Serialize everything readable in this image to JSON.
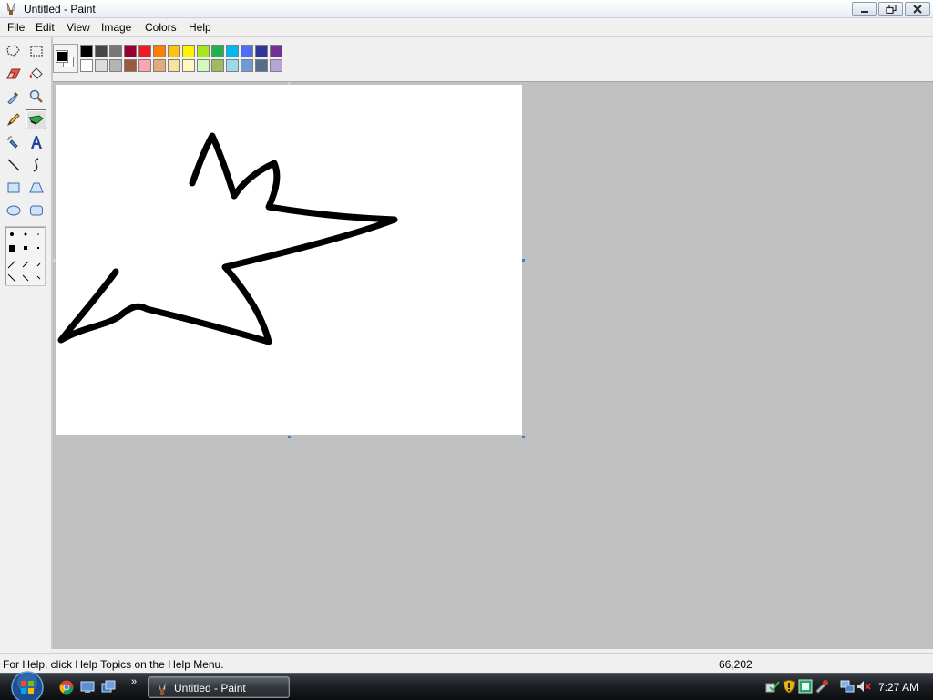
{
  "window": {
    "title": "Untitled - Paint"
  },
  "menu": {
    "items": [
      "File",
      "Edit",
      "View",
      "Image",
      "Colors",
      "Help"
    ]
  },
  "tools": [
    "free-form-select",
    "select",
    "eraser",
    "fill-with-color",
    "pick-color",
    "magnifier",
    "pencil",
    "brush",
    "airbrush",
    "text",
    "line",
    "curve",
    "rectangle",
    "polygon",
    "ellipse",
    "rounded-rectangle"
  ],
  "active_tool": "brush",
  "colors": {
    "foreground": "#000000",
    "background": "#ffffff",
    "palette_top": [
      "#000000",
      "#464646",
      "#787878",
      "#990030",
      "#ed1c24",
      "#ff7e00",
      "#ffc20e",
      "#fff200",
      "#a8e61d",
      "#22b14c",
      "#00b7ef",
      "#4d6df3",
      "#2f3699",
      "#6f3198"
    ],
    "palette_bottom": [
      "#ffffff",
      "#dcdcdc",
      "#b4b4b4",
      "#9c5a3c",
      "#ffa3b1",
      "#e5aa7a",
      "#f5e49c",
      "#fff9bd",
      "#d3f9bc",
      "#9dbb61",
      "#99d9ea",
      "#709ad1",
      "#546d8e",
      "#b5a5d5"
    ]
  },
  "status": {
    "help_text": "For Help, click Help Topics on the Help Menu.",
    "coordinates": "66,202"
  },
  "taskbar": {
    "task_label": "Untitled - Paint",
    "clock": "7:27 AM"
  }
}
